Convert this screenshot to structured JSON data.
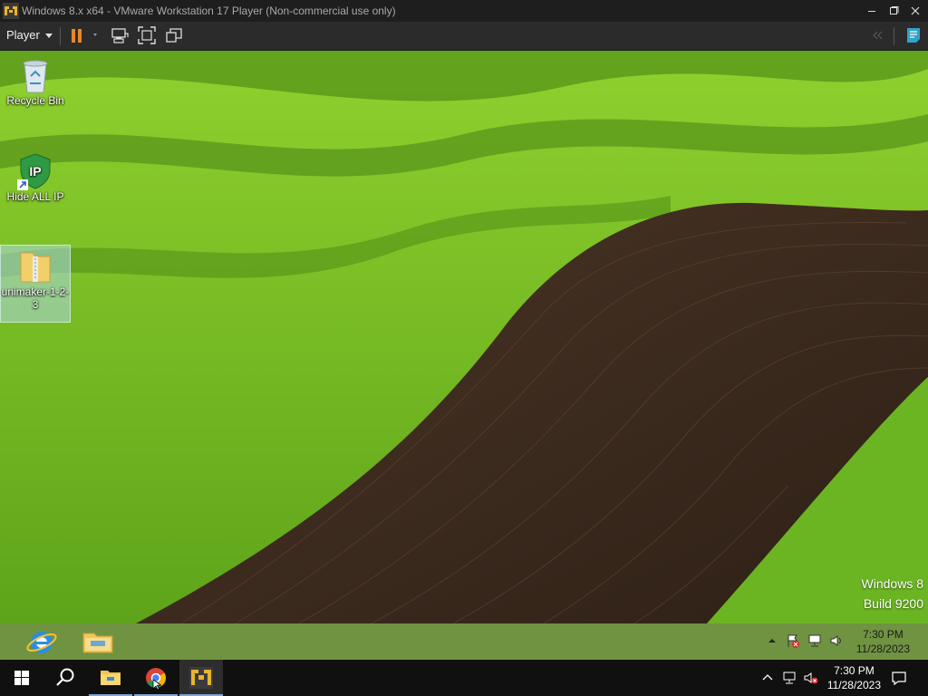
{
  "window": {
    "title": "Windows 8.x x64 - VMware Workstation 17 Player (Non-commercial use only)",
    "icons": {
      "app": "vmware-logo-icon",
      "minimize": "minimize-icon",
      "maximize": "maximize-icon",
      "close": "close-icon"
    }
  },
  "toolbar": {
    "player_menu_label": "Player",
    "buttons": [
      "pause-icon",
      "send-ctrl-alt-del-icon",
      "fullscreen-icon",
      "unity-icon",
      "library-collapse-icon",
      "message-log-icon"
    ]
  },
  "desktop": {
    "icons": [
      {
        "label": "Recycle Bin",
        "icon": "recycle-bin-icon"
      },
      {
        "label": "Hide ALL IP",
        "icon": "shield-ip-icon",
        "shortcut": true
      },
      {
        "label": "unimaker-1-2-3",
        "icon": "zip-folder-icon",
        "selected": true
      }
    ],
    "watermark": {
      "line1": "Windows 8",
      "line2": "Build 9200"
    }
  },
  "guest_taskbar": {
    "pinned": [
      "internet-explorer-icon",
      "file-explorer-icon"
    ],
    "tray": [
      "show-hidden-icons-icon",
      "action-center-flag-icon",
      "network-icon",
      "volume-icon"
    ],
    "clock": {
      "time": "7:30 PM",
      "date": "11/28/2023"
    }
  },
  "host_taskbar": {
    "items": [
      "windows-start-icon",
      "search-icon",
      "file-explorer-icon",
      "chrome-icon",
      "vmware-player-icon"
    ],
    "tray": [
      "show-hidden-icons-icon",
      "network-icon",
      "volume-muted-icon",
      "notifications-icon"
    ],
    "clock": {
      "time": "7:30 PM",
      "date": "11/28/2023"
    }
  },
  "colors": {
    "title_bg": "#1e1e1e",
    "toolbar_bg": "#2b2b2b",
    "accent_orange": "#e8862a",
    "host_taskbar_bg": "#101010"
  }
}
